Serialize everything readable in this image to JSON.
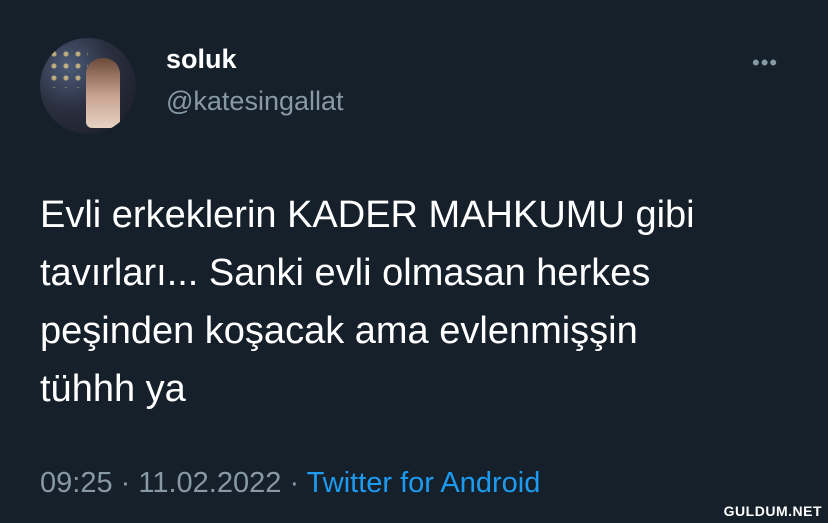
{
  "user": {
    "name": "soluk",
    "handle": "@katesingallat"
  },
  "more_icon": "more-horizontal-icon",
  "tweet_text_lines": [
    "Evli erkeklerin KADER MAHKUMU gibi",
    "tavırları... Sanki evli olmasan herkes",
    "peşinden koşacak ama evlenmişşin",
    "tühhh ya"
  ],
  "meta": {
    "time": "09:25",
    "separator": "·",
    "date": "11.02.2022",
    "source": "Twitter for Android"
  },
  "watermark": "GULDUM.NET",
  "colors": {
    "background": "#15202b",
    "secondary_text": "#8899a6",
    "link": "#1d9bf0"
  }
}
